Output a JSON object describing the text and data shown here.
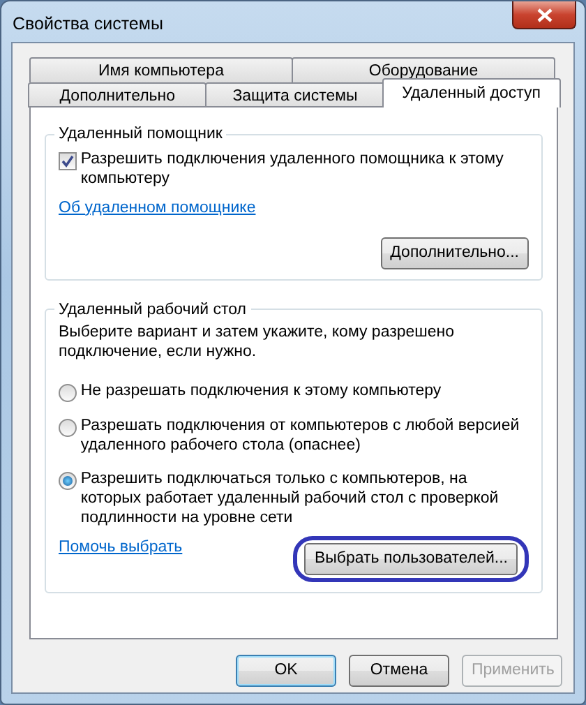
{
  "window": {
    "title": "Свойства системы"
  },
  "tab_rows": [
    {
      "tabs": [
        {
          "label": "Имя компьютера",
          "selected": false
        },
        {
          "label": "Оборудование",
          "selected": false
        }
      ]
    },
    {
      "tabs": [
        {
          "label": "Дополнительно",
          "selected": false
        },
        {
          "label": "Защита системы",
          "selected": false
        },
        {
          "label": "Удаленный доступ",
          "selected": true
        }
      ]
    }
  ],
  "remote_assistance": {
    "title": "Удаленный помощник",
    "checkbox": {
      "label": "Разрешить подключения удаленного помощника к этому компьютеру",
      "checked": true
    },
    "link": "Об удаленном помощнике",
    "button": "Дополнительно..."
  },
  "remote_desktop": {
    "title": "Удаленный рабочий стол",
    "description": "Выберите вариант и затем укажите, кому разрешено подключение, если нужно.",
    "options": [
      {
        "label": "Не разрешать подключения к этому компьютеру",
        "selected": false
      },
      {
        "label": "Разрешать подключения от компьютеров с любой версией удаленного рабочего стола (опаснее)",
        "selected": false
      },
      {
        "label": "Разрешить подключаться только с компьютеров, на которых работает удаленный рабочий стол с проверкой подлинности на уровне сети",
        "selected": true
      }
    ],
    "link": "Помочь выбрать",
    "button": {
      "label": "Выбрать пользователей...",
      "highlighted": true
    }
  },
  "buttons": [
    {
      "label": "OK",
      "default": true,
      "disabled": false
    },
    {
      "label": "Отмена",
      "default": false,
      "disabled": false
    },
    {
      "label": "Применить",
      "default": false,
      "disabled": true
    }
  ]
}
